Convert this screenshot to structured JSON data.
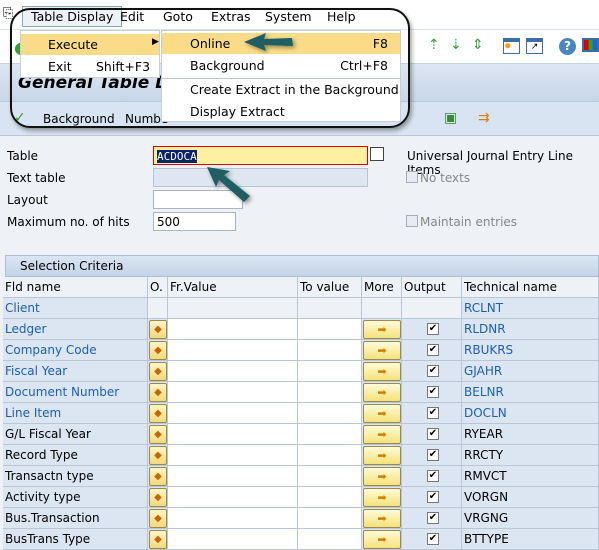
{
  "menubar": {
    "items": [
      "Table Display",
      "Edit",
      "Goto",
      "Extras",
      "System",
      "Help"
    ]
  },
  "title": "General Table Dis",
  "app_toolbar": {
    "background": "Background",
    "number": "Numbe"
  },
  "menu": {
    "items": [
      {
        "label": "Execute",
        "has_submenu": true
      },
      {
        "label": "Exit",
        "shortcut": "Shift+F3"
      }
    ]
  },
  "submenu": {
    "items": [
      {
        "label": "Online",
        "shortcut": "F8"
      },
      {
        "label": "Background",
        "shortcut": "Ctrl+F8"
      },
      {
        "label": "Create Extract in the Background"
      },
      {
        "label": "Display Extract"
      }
    ]
  },
  "form": {
    "table_label": "Table",
    "table_value": "ACDOCA",
    "table_desc": "Universal Journal Entry Line Items",
    "text_table_label": "Text table",
    "no_texts": "No texts",
    "layout_label": "Layout",
    "max_hits_label": "Maximum no. of hits",
    "max_hits_value": "500",
    "maintain_entries": "Maintain entries"
  },
  "selection": {
    "title": "Selection Criteria",
    "columns": [
      "Fld name",
      "O.",
      "Fr.Value",
      "To value",
      "More",
      "Output",
      "Technical name"
    ],
    "rows": [
      {
        "name": "Client",
        "tech": "RCLNT",
        "key": true,
        "editable": false,
        "output": false
      },
      {
        "name": "Ledger",
        "tech": "RLDNR",
        "key": true,
        "editable": true,
        "output": true
      },
      {
        "name": "Company Code",
        "tech": "RBUKRS",
        "key": true,
        "editable": true,
        "output": true
      },
      {
        "name": "Fiscal Year",
        "tech": "GJAHR",
        "key": true,
        "editable": true,
        "output": true
      },
      {
        "name": "Document Number",
        "tech": "BELNR",
        "key": true,
        "editable": true,
        "output": true
      },
      {
        "name": "Line Item",
        "tech": "DOCLN",
        "key": true,
        "editable": true,
        "output": true
      },
      {
        "name": "G/L Fiscal Year",
        "tech": "RYEAR",
        "key": false,
        "editable": true,
        "output": true
      },
      {
        "name": "Record Type",
        "tech": "RRCTY",
        "key": false,
        "editable": true,
        "output": true
      },
      {
        "name": "Transactn type",
        "tech": "RMVCT",
        "key": false,
        "editable": true,
        "output": true
      },
      {
        "name": "Activity type",
        "tech": "VORGN",
        "key": false,
        "editable": true,
        "output": true
      },
      {
        "name": "Bus.Transaction",
        "tech": "VRGNG",
        "key": false,
        "editable": true,
        "output": true
      },
      {
        "name": "BusTrans Type",
        "tech": "BTTYPE",
        "key": false,
        "editable": true,
        "output": true
      }
    ]
  },
  "colors": {
    "key_field": "#1d5fae",
    "menu_highlight": "#fadc88",
    "arrow": "#1f5f63"
  }
}
